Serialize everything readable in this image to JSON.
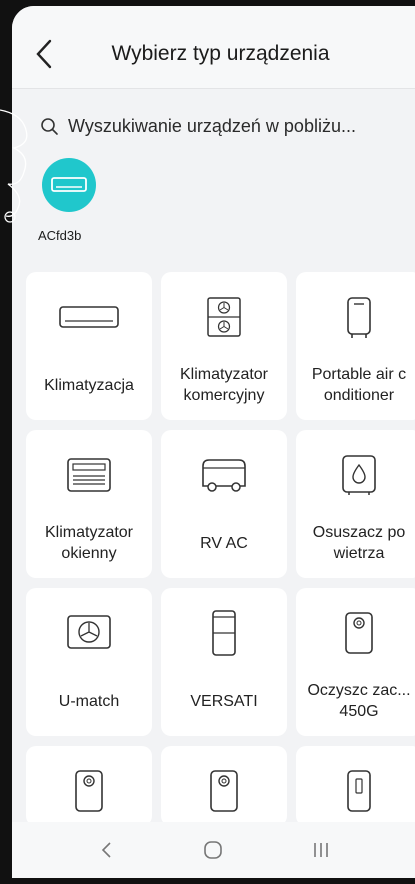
{
  "header": {
    "title": "Wybierz typ urządzenia"
  },
  "search": {
    "label": "Wyszukiwanie urządzeń w pobliżu..."
  },
  "nearby_device": {
    "name": "ACfd3b",
    "color": "#20c7cc"
  },
  "devices": [
    {
      "label": "Klimatyzacja",
      "icon": "split-ac-icon"
    },
    {
      "label": "Klimatyzator komercyjny",
      "icon": "commercial-ac-icon"
    },
    {
      "label": "Portable air c onditioner",
      "icon": "portable-ac-icon"
    },
    {
      "label": "Klimatyzator okienny",
      "icon": "window-ac-icon"
    },
    {
      "label": "RV AC",
      "icon": "rv-ac-icon"
    },
    {
      "label": "Osuszacz po wietrza",
      "icon": "dehumidifier-icon"
    },
    {
      "label": "U-match",
      "icon": "u-match-icon"
    },
    {
      "label": "VERSATI",
      "icon": "versati-icon"
    },
    {
      "label": "Oczyszc zac... 450G",
      "icon": "air-purifier-icon"
    }
  ],
  "partial_row_icons": [
    "air-purifier-icon",
    "air-purifier-icon",
    "tower-device-icon"
  ],
  "navbar": {
    "back": "back-nav-icon",
    "home": "home-nav-icon",
    "recents": "recents-nav-icon"
  }
}
